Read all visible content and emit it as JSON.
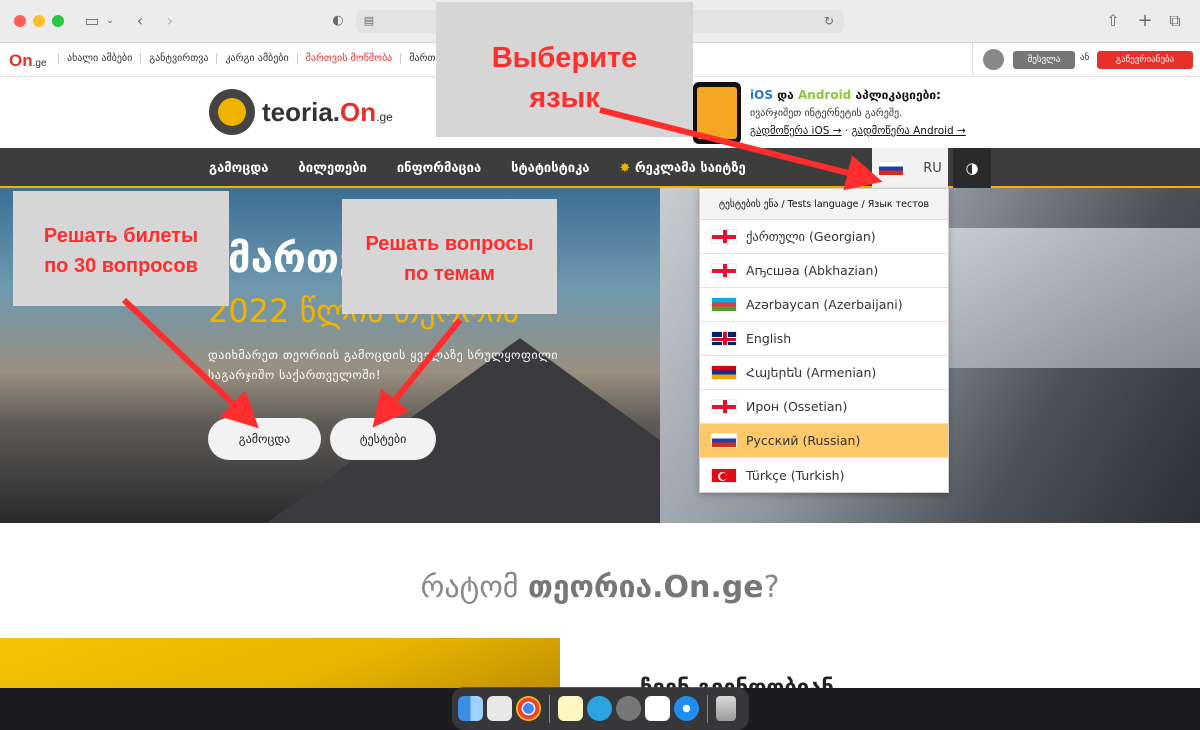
{
  "site_top": {
    "logo_on": "On",
    "logo_ge": ".ge",
    "links": [
      "ახალი ამბები",
      "განტვირთვა",
      "კარგი ამბები",
      "მართვის მოწმობა",
      "მართ"
    ],
    "login_label": "შესვლა",
    "or_label": "ან",
    "register_label": "გაწევრიანება"
  },
  "header": {
    "logo_main": "teoria.",
    "logo_accent": "On",
    "logo_ge": ".ge",
    "app_title_ios": "iOS",
    "app_title_and": " და ",
    "app_title_android": "Android",
    "app_title_rest": " აპლიკაციები:",
    "app_sub": "ივარჯიშეთ ინტერნეტის გარეშე.",
    "app_link_ios": "გადმოწერა iOS →",
    "app_link_sep": " · ",
    "app_link_android": "გადმოწერა Android →"
  },
  "nav": {
    "items": [
      "გამოცდა",
      "ბილეთები",
      "ინფორმაცია",
      "სტატისტიკა"
    ],
    "ads_star": "✸",
    "ads_label": "რეკლამა საიტზე",
    "lang_code": "RU",
    "theme_glyph": "◑"
  },
  "hero": {
    "title": "მართვის",
    "year": "2022 წლის თეორია",
    "desc_line1": "დაიხმარეთ თეორიის გამოცდის ყველაზე სრულყოფილი",
    "desc_line2": "საგარჯიშო საქართველოში!",
    "btn_exam": "გამოცდა",
    "btn_tests": "ტესტები"
  },
  "dropdown": {
    "header": "ტესტების ენა / Tests language / Язык тестов",
    "languages": [
      "ქართული (Georgian)",
      "Аҧсшәа (Abkhazian)",
      "Azərbaycan (Azerbaijani)",
      "English",
      "Հայերեն (Armenian)",
      "Ирон (Ossetian)",
      "Русский (Russian)",
      "Türkçe (Turkish)"
    ],
    "active_index": 6
  },
  "why": {
    "prefix": "რატომ ",
    "brand": "თეორია.On.ge",
    "suffix": "?",
    "next_heading": "ჩვენ გვენდობიან"
  },
  "annotations": {
    "choose_lang": [
      "Выберите",
      "язык"
    ],
    "tickets": [
      "Решать билеты",
      "по 30 вопросов"
    ],
    "topics": [
      "Решать вопросы",
      "по темам"
    ]
  },
  "colors": {
    "accent_red": "#e8302b",
    "accent_yellow": "#f0b400",
    "annotation_red": "#ff2d2d",
    "active_language": "#ffc868"
  }
}
